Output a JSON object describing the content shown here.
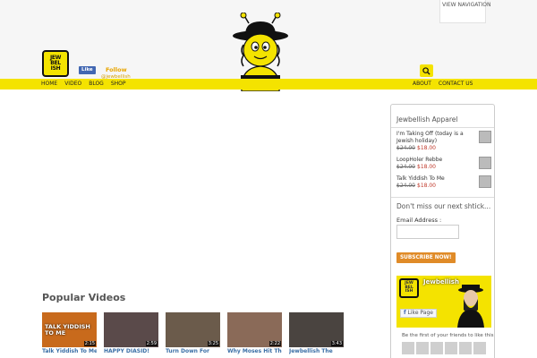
{
  "header": {
    "view_navigation": "VIEW NAVIGATION",
    "logo_lines": [
      "JEW",
      "BEL",
      "ISH"
    ],
    "fb_like": "Like",
    "follow": "Follow",
    "follow_handle": "@jewbellish"
  },
  "nav": {
    "left": [
      "HOME",
      "VIDEO",
      "BLOG",
      "SHOP"
    ],
    "right": [
      "ABOUT",
      "CONTACT US"
    ]
  },
  "popular": {
    "title": "Popular Videos",
    "videos": [
      {
        "title": "Talk Yiddish To Me",
        "duration": "2:15",
        "overlay": "TALK YIDDISH TO ME",
        "color": "#c86a1c"
      },
      {
        "title": "HAPPY DIASID!",
        "duration": "2:59",
        "overlay": "",
        "color": "#5a4a4a"
      },
      {
        "title": "Turn Down For",
        "duration": "3:25",
        "overlay": "",
        "color": "#6b5b4b"
      },
      {
        "title": "Why Moses Hit The",
        "duration": "2:22",
        "overlay": "",
        "color": "#8a6a58"
      },
      {
        "title": "Jewbellish The",
        "duration": "3:43",
        "overlay": "",
        "color": "#4a4440"
      }
    ]
  },
  "sidebar": {
    "apparel_title": "Jewbellish Apparel",
    "products": [
      {
        "name": "I'm Taking Off (today is a Jewish holiday)",
        "old_price": "$24.00",
        "new_price": "$18.00"
      },
      {
        "name": "LoopHoler Rebbe",
        "old_price": "$24.00",
        "new_price": "$18.00"
      },
      {
        "name": "Talk Yiddish To Me",
        "old_price": "$24.00",
        "new_price": "$18.00"
      }
    ],
    "newsletter_title": "Don't miss our next shtick...",
    "email_label": "Email Address :",
    "subscribe": "SUBSCRIBE NOW!",
    "fb_page_name": "Jewbellish",
    "fb_likes": "",
    "fb_like_page": "Like Page",
    "friends_text": "Be the first of your friends to like this"
  },
  "colors": {
    "brand_yellow": "#f4e300",
    "accent_orange": "#e08b28",
    "link_blue": "#3a6ea5"
  }
}
